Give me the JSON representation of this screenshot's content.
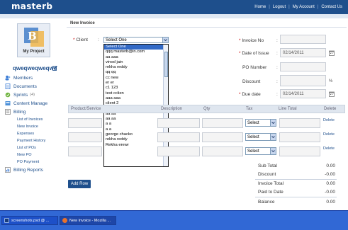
{
  "header": {
    "logo": "masterb",
    "nav": [
      "Home",
      "Logout",
      "My Account",
      "Contact Us"
    ],
    "separator": "|"
  },
  "sidebar": {
    "project_label": "My Project",
    "user_name": "qweqweqweqwe",
    "items": [
      {
        "label": "Members",
        "icon": "members-icon",
        "count": ""
      },
      {
        "label": "Documents",
        "icon": "documents-icon",
        "count": ""
      },
      {
        "label": "Sprints",
        "icon": "sprints-icon",
        "count": "(4)"
      },
      {
        "label": "Content Manage",
        "icon": "content-icon",
        "count": ""
      },
      {
        "label": "Billing",
        "icon": "billing-icon",
        "count": ""
      }
    ],
    "billing_subitems": [
      "List of Invoices",
      "New Invoice",
      "Expenses",
      "Payment History",
      "List of POs",
      "New PO",
      "PO Payment"
    ],
    "billing_reports": "Billing Reports"
  },
  "form": {
    "title": "New Invoice",
    "client_label": "Client",
    "client_selected": "Select One",
    "client_options": [
      "Select One",
      "qqq masterb@in.com",
      "aa aaa",
      "vinod jain",
      "rekha reddy",
      "qq qq",
      "cc new",
      "er er",
      "c1 123",
      "test cclien",
      "aaa aaa",
      "client 2",
      "aa aa",
      "aa aa",
      "aa aa",
      "a a",
      "a a",
      "george chacko",
      "rekha reddy",
      "Rekha erewr"
    ],
    "invoice_no_label": "Invoice No",
    "date_of_issue_label": "Date of Issue",
    "date_of_issue_value": "02/14/2011",
    "po_number_label": "PO Number",
    "discount_label": "Discount",
    "discount_unit": "%",
    "due_date_label": "Due date",
    "due_date_value": "02/14/2011",
    "colon": ":"
  },
  "grid": {
    "headers": [
      "Product/Service",
      "Description",
      "Qty",
      "Tax",
      "Line Total",
      "Delete"
    ],
    "rows": [
      {
        "tax": "Select",
        "delete": "Delete"
      },
      {
        "tax": "Select",
        "delete": "Delete"
      },
      {
        "tax": "Select",
        "delete": "Delete"
      }
    ],
    "add_row": "Add Row"
  },
  "totals": [
    {
      "label": "Sub Total",
      "value": "0.00"
    },
    {
      "label": "Discount",
      "value": "-0.00"
    },
    {
      "label": "Invoice Total",
      "value": "0.00"
    },
    {
      "label": "Paid to Date",
      "value": "-0.00"
    },
    {
      "label": "Balance",
      "value": "0.00"
    }
  ],
  "taskbar": {
    "buttons": [
      "screenshots.psd @ ...",
      "New Invoice - Mozilla ..."
    ]
  },
  "colors": {
    "header_bg": "#1e4f8c",
    "link": "#1e4f8c",
    "required": "#cc0000",
    "taskbar": "#3168d5",
    "selection": "#3169c6"
  }
}
